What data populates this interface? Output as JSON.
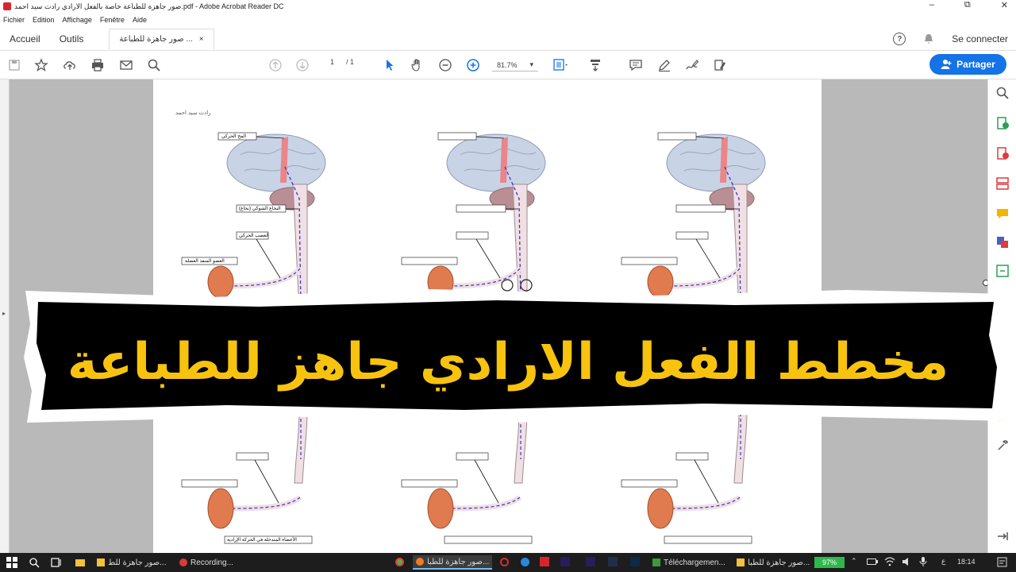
{
  "window": {
    "title": "صور جاهزة للطباعة خاصة بالفعل الارادي  رادت سيد احمد.pdf - Adobe Acrobat Reader DC",
    "minimize": "–",
    "maximize": "⧉",
    "close": "✕"
  },
  "menu": [
    "Fichier",
    "Edition",
    "Affichage",
    "Fenêtre",
    "Aide"
  ],
  "tabs": {
    "home": "Accueil",
    "tools": "Outils",
    "doc": "صور جاهزة للطباعة ...",
    "doc_close": "×"
  },
  "header_right": {
    "help": "?",
    "connect": "Se connecter"
  },
  "toolbar": {
    "page_current": "1",
    "page_total": "/ 1",
    "zoom": "81.7%",
    "zoom_arrow": "▾",
    "share_label": "Partager"
  },
  "document": {
    "header_note": "رادت سيد احمد",
    "diagram_labels": {
      "cortex": "المخ الحركي",
      "spinal": "النخاع الشوكي (نخاع)",
      "nerve": "العصب الحركي",
      "muscle": "العضو المنفذ العضلة",
      "footer": "الأعضاء المتدخلة في الحركة الإرادية"
    }
  },
  "banner": {
    "text": "مخطط الفعل الارادي جاهز للطباعة",
    "text_color": "#f7c30f",
    "bg_color": "#000000"
  },
  "taskbar": {
    "items": [
      {
        "label": "صور جاهزة للط..."
      },
      {
        "label": "Recording..."
      },
      {
        "label": "صور جاهزة للطبا..."
      },
      {
        "label": "Téléchargemen..."
      },
      {
        "label": "صور جاهزة للطبا..."
      }
    ],
    "battery": "97%",
    "lang": "ع",
    "time": "18:14"
  }
}
